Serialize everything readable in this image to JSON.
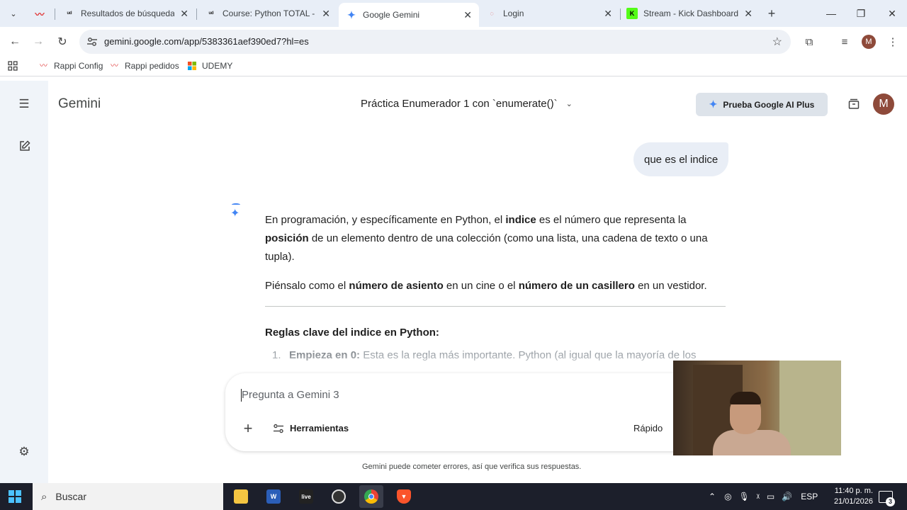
{
  "browser": {
    "tabs": [
      {
        "title": "",
        "favicon": "rappi-mustache-icon",
        "color": "#e03a3a"
      },
      {
        "title": "Resultados de búsqueda | Udemy",
        "favicon": "udemy-icon",
        "close": "✕"
      },
      {
        "title": "Course: Python TOTAL - Programa",
        "favicon": "udemy-icon",
        "close": "✕"
      },
      {
        "title": "Google Gemini",
        "favicon": "gemini-icon",
        "close": "✕",
        "active": true
      },
      {
        "title": "Login",
        "favicon": "loading-icon",
        "close": "✕"
      },
      {
        "title": "Stream - Kick Dashboard",
        "favicon": "kick-icon",
        "close": "✕"
      }
    ],
    "url": "gemini.google.com/app/5383361aef390ed7?hl=es",
    "profile_initial": "M",
    "bookmarks": [
      {
        "label": "Rappi Config",
        "icon": "rappi-mustache-icon"
      },
      {
        "label": "Rappi pedidos",
        "icon": "rappi-mustache-icon"
      },
      {
        "label": "UDEMY",
        "icon": "microsoft-icon"
      }
    ]
  },
  "gemini": {
    "app_title": "Gemini",
    "chat_title": "Práctica Enumerador 1 con `enumerate()`",
    "upgrade_label": "Prueba Google AI Plus",
    "avatar_initial": "M",
    "user_message": "que es el indice",
    "response": {
      "p1_a": "En programación, y específicamente en Python, el ",
      "p1_b": "indice",
      "p1_c": " es el número que representa la ",
      "p1_d": "posición",
      "p1_e": " de un elemento dentro de una colección (como una lista, una cadena de texto o una tupla).",
      "p2_a": "Piénsalo como el ",
      "p2_b": "número de asiento",
      "p2_c": " en un cine o el ",
      "p2_d": "número de un casillero",
      "p2_e": " en un vestidor.",
      "heading": "Reglas clave del indice en Python:",
      "item1_num": "1.",
      "item1_bold": "Empieza en 0:",
      "item1_text": " Esta es la regla más importante. Python (al igual que la mayoría de los"
    },
    "input_placeholder": "Pregunta a Gemini 3",
    "tools_label": "Herramientas",
    "mode_label": "Rápido",
    "disclaimer": "Gemini puede cometer errores, así que verifica sus respuestas."
  },
  "taskbar": {
    "search_label": "Buscar",
    "apps": [
      "file-explorer-icon",
      "word-icon",
      "live-icon",
      "obs-icon",
      "chrome-icon",
      "brave-icon"
    ],
    "language": "ESP",
    "time": "11:40 p. m.",
    "date": "21/01/2026",
    "notification_count": "3"
  }
}
